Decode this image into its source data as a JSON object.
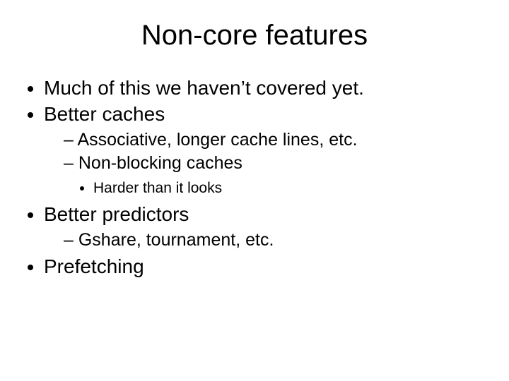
{
  "title": "Non-core features",
  "b1": "Much of this we haven’t covered yet.",
  "b2": "Better caches",
  "b2_1": "Associative, longer cache lines, etc.",
  "b2_2": "Non-blocking caches",
  "b2_2_1": "Harder than it looks",
  "b3": "Better predictors",
  "b3_1": "Gshare, tournament, etc.",
  "b4": "Prefetching"
}
